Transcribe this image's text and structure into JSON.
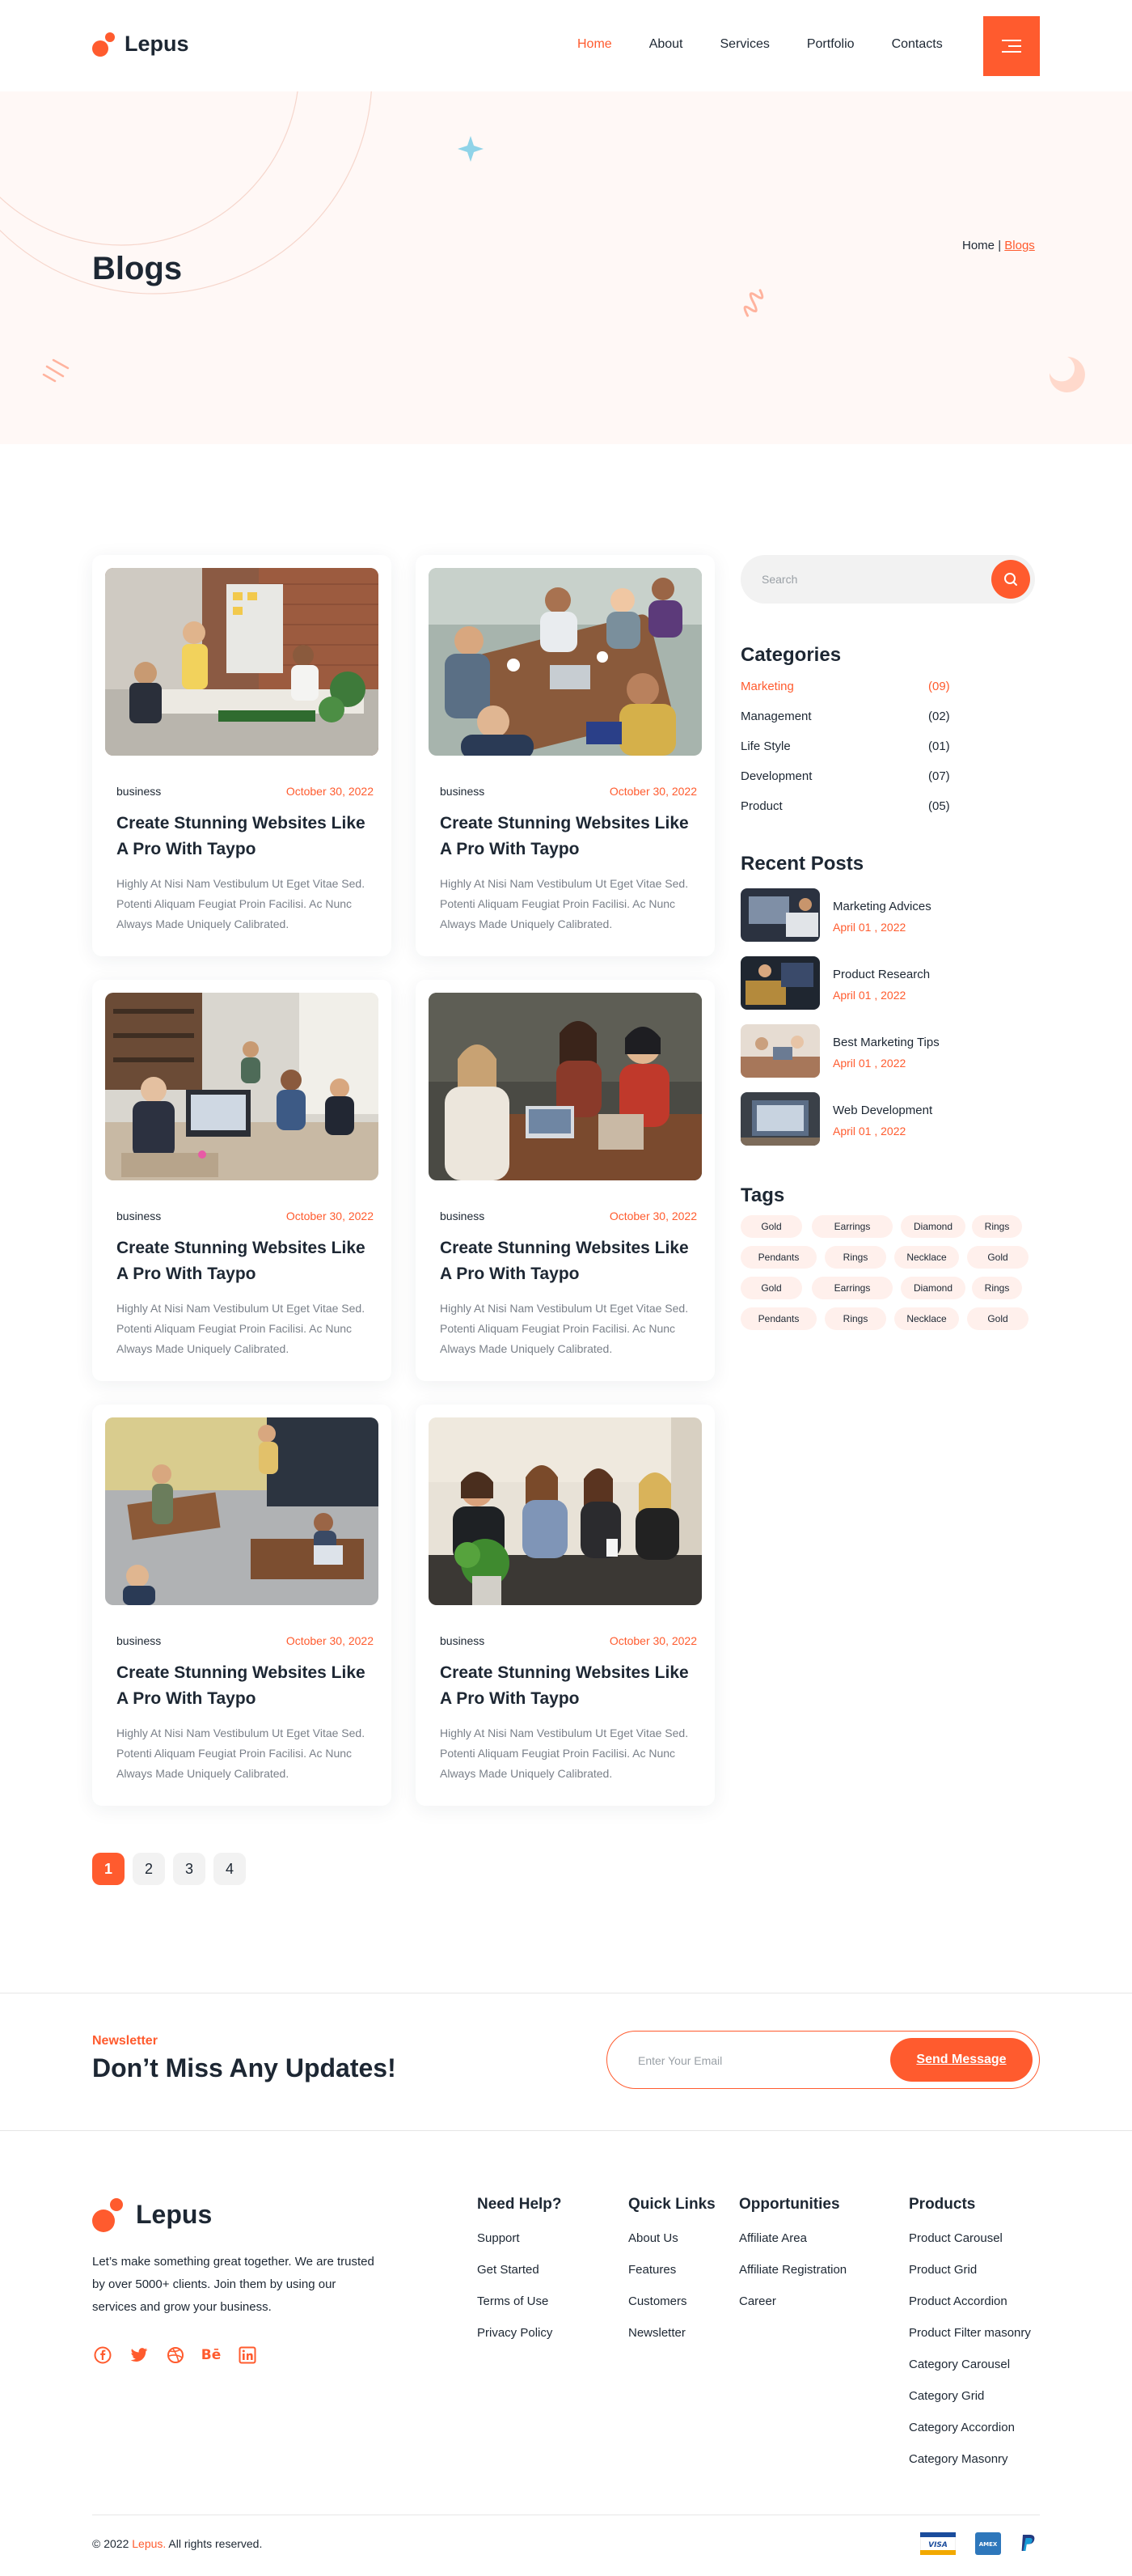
{
  "brand": {
    "name": "Lepus"
  },
  "nav": [
    {
      "label": "Home",
      "active": true
    },
    {
      "label": "About",
      "active": false
    },
    {
      "label": "Services",
      "active": false
    },
    {
      "label": "Portfolio",
      "active": false
    },
    {
      "label": "Contacts",
      "active": false
    }
  ],
  "hero": {
    "title": "Blogs",
    "breadcrumb": {
      "home": "Home",
      "separator": "|",
      "current": "Blogs"
    }
  },
  "posts": [
    {
      "category": "business",
      "date": "October 30, 2022",
      "title": "Create Stunning Websites Like A Pro With Taypo",
      "excerpt": "Highly At Nisi Nam Vestibulum Ut Eget Vitae Sed. Potenti Aliquam Feugiat Proin Facilisi. Ac Nunc Always Made Uniquely Calibrated.",
      "image": "office-presentation-photo"
    },
    {
      "category": "business",
      "date": "October 30, 2022",
      "title": "Create Stunning Websites Like A Pro With Taypo",
      "excerpt": "Highly At Nisi Nam Vestibulum Ut Eget Vitae Sed. Potenti Aliquam Feugiat Proin Facilisi. Ac Nunc Always Made Uniquely Calibrated.",
      "image": "team-meeting-photo"
    },
    {
      "category": "business",
      "date": "October 30, 2022",
      "title": "Create Stunning Websites Like A Pro With Taypo",
      "excerpt": "Highly At Nisi Nam Vestibulum Ut Eget Vitae Sed. Potenti Aliquam Feugiat Proin Facilisi. Ac Nunc Always Made Uniquely Calibrated.",
      "image": "open-office-photo"
    },
    {
      "category": "business",
      "date": "October 30, 2022",
      "title": "Create Stunning Websites Like A Pro With Taypo",
      "excerpt": "Highly At Nisi Nam Vestibulum Ut Eget Vitae Sed. Potenti Aliquam Feugiat Proin Facilisi. Ac Nunc Always Made Uniquely Calibrated.",
      "image": "laughing-colleagues-photo"
    },
    {
      "category": "business",
      "date": "October 30, 2022",
      "title": "Create Stunning Websites Like A Pro With Taypo",
      "excerpt": "Highly At Nisi Nam Vestibulum Ut Eget Vitae Sed. Potenti Aliquam Feugiat Proin Facilisi. Ac Nunc Always Made Uniquely Calibrated.",
      "image": "workspace-overhead-photo"
    },
    {
      "category": "business",
      "date": "October 30, 2022",
      "title": "Create Stunning Websites Like A Pro With Taypo",
      "excerpt": "Highly At Nisi Nam Vestibulum Ut Eget Vitae Sed. Potenti Aliquam Feugiat Proin Facilisi. Ac Nunc Always Made Uniquely Calibrated.",
      "image": "women-discussion-photo"
    }
  ],
  "pagination": {
    "pages": [
      "1",
      "2",
      "3",
      "4"
    ],
    "current": "1"
  },
  "sidebar": {
    "search_placeholder": "Search",
    "categories_title": "Categories",
    "categories": [
      {
        "name": "Marketing",
        "count": "(09)",
        "active": true
      },
      {
        "name": "Management",
        "count": "(02)",
        "active": false
      },
      {
        "name": "Life Style",
        "count": "(01)",
        "active": false
      },
      {
        "name": "Development",
        "count": "(07)",
        "active": false
      },
      {
        "name": "Product",
        "count": "(05)",
        "active": false
      }
    ],
    "recent_title": "Recent Posts",
    "recent_posts": [
      {
        "title": "Marketing Advices",
        "date": "April 01 , 2022"
      },
      {
        "title": "Product Research",
        "date": "April 01 , 2022"
      },
      {
        "title": "Best Marketing Tips",
        "date": "April 01 , 2022"
      },
      {
        "title": "Web Development",
        "date": "April 01 , 2022"
      }
    ],
    "tags_title": "Tags",
    "tags": [
      "Gold",
      "Earrings",
      "Diamond",
      "Rings",
      "Pendants",
      "Rings",
      "Necklace",
      "Gold",
      "Gold",
      "Earrings",
      "Diamond",
      "Rings",
      "Pendants",
      "Rings",
      "Necklace",
      "Gold"
    ]
  },
  "newsletter": {
    "eyebrow": "Newsletter",
    "title": "Don’t Miss Any Updates!",
    "email_placeholder": "Enter Your Email",
    "button": "Send Message"
  },
  "footer": {
    "description": "Let’s make something great together. We are trusted by over 5000+ clients. Join them by using our services and grow your business.",
    "social": [
      "facebook-icon",
      "twitter-icon",
      "dribbble-icon",
      "behance-icon",
      "linkedin-icon"
    ],
    "columns": [
      {
        "title": "Need Help?",
        "links": [
          "Support",
          "Get Started",
          "Terms of Use",
          "Privacy Policy"
        ]
      },
      {
        "title": "Quick Links",
        "links": [
          "About Us",
          "Features",
          "Customers",
          "Newsletter"
        ]
      },
      {
        "title": "Opportunities",
        "links": [
          "Affiliate Area",
          "Affiliate Registration",
          "Career"
        ]
      },
      {
        "title": "Products",
        "links": [
          "Product Carousel",
          "Product Grid",
          "Product Accordion",
          "Product Filter masonry",
          "Category Carousel",
          "Category Grid",
          "Category Accordion",
          "Category Masonry"
        ]
      }
    ],
    "copyright_prefix": "© 2022",
    "copyright_brand": "Lepus.",
    "copyright_suffix": "All rights reserved.",
    "payments": [
      "VISA",
      "AMEX",
      "PayPal"
    ]
  },
  "colors": {
    "accent": "#ff5b2e",
    "text": "#1d2733",
    "muted": "#7a8089",
    "hero_bg": "#fff8f6",
    "tag_bg": "#fff0ec"
  }
}
